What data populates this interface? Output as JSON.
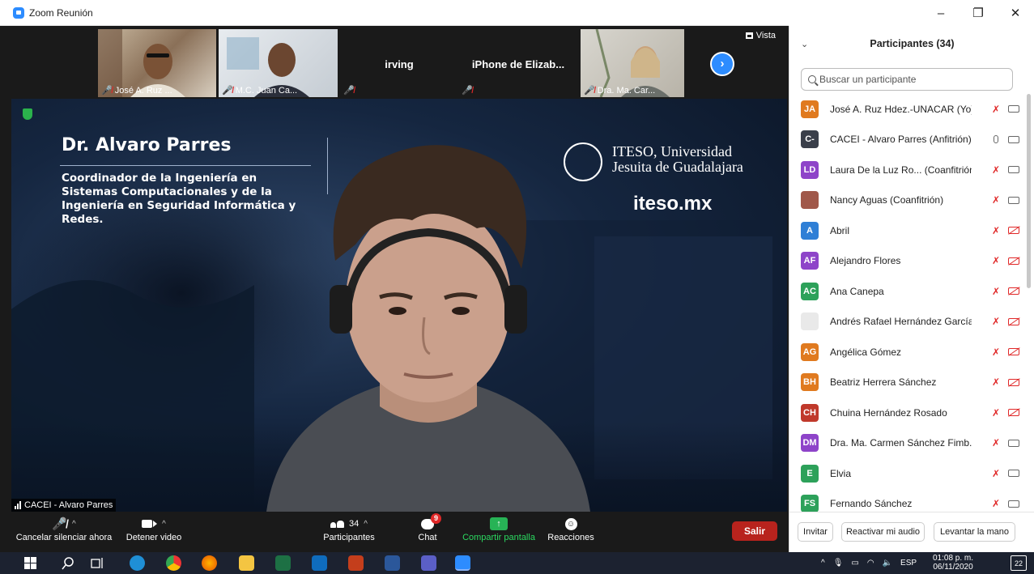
{
  "window": {
    "title": "Zoom Reunión",
    "minimize": "–",
    "maximize": "❐",
    "close": "✕"
  },
  "strip": {
    "thumbnails": [
      {
        "label": "José A. Ruz ...",
        "muted": true
      },
      {
        "label": "M.C. Juan Ca...",
        "muted": true
      },
      {
        "center_name": "irving",
        "muted": true
      },
      {
        "center_name": "iPhone de Elizab...",
        "muted": true
      },
      {
        "label": "Dra. Ma. Car...",
        "muted": true
      }
    ],
    "view_label": "Vista",
    "next_icon": "chevron-right-icon"
  },
  "main_video": {
    "slide_name": "Dr. Alvaro Parres",
    "slide_role": "Coordinador de la Ingeniería en Sistemas Computacionales y de la Ingeniería en Seguridad Informática y Redes.",
    "org_name_line1": "ITESO, Universidad",
    "org_name_line2": "Jesuita de Guadalajara",
    "org_url": "iteso.mx",
    "participant_label": "CACEI - Alvaro Parres"
  },
  "toolbar": {
    "mute_label": "Cancelar silenciar ahora",
    "video_label": "Detener video",
    "participants_label": "Participantes",
    "participants_count": "34",
    "chat_label": "Chat",
    "chat_badge": "9",
    "share_label": "Compartir pantalla",
    "reactions_label": "Reacciones",
    "leave_label": "Salir"
  },
  "panel": {
    "title": "Participantes (34)",
    "search_placeholder": "Buscar un participante",
    "participants": [
      {
        "initials": "JA",
        "color": "#e07a1f",
        "name": "José A. Ruz Hdez.-UNACAR (Yo)",
        "mic": "off",
        "video": "on"
      },
      {
        "initials": "C-",
        "color": "#3a3f4a",
        "name": "CACEI - Alvaro Parres (Anfitrión)",
        "mic": "on",
        "video": "on"
      },
      {
        "initials": "LD",
        "color": "#8e44c9",
        "name": "Laura De la Luz Ro... (Coanfitrión)",
        "mic": "off",
        "video": "on"
      },
      {
        "initials": "",
        "color": "#a0584a",
        "name": "Nancy Aguas (Coanfitrión)",
        "mic": "off",
        "video": "on"
      },
      {
        "initials": "A",
        "color": "#2f7fd6",
        "name": "Abril",
        "mic": "off",
        "video": "off"
      },
      {
        "initials": "AF",
        "color": "#8e44c9",
        "name": "Alejandro Flores",
        "mic": "off",
        "video": "off"
      },
      {
        "initials": "AC",
        "color": "#2da15a",
        "name": "Ana Canepa",
        "mic": "off",
        "video": "off"
      },
      {
        "initials": "",
        "color": "#e9e9e9",
        "name": "Andrés Rafael Hernández García",
        "mic": "off",
        "video": "off"
      },
      {
        "initials": "AG",
        "color": "#e07a1f",
        "name": "Angélica Gómez",
        "mic": "off",
        "video": "off"
      },
      {
        "initials": "BH",
        "color": "#e07a1f",
        "name": "Beatriz Herrera Sánchez",
        "mic": "off",
        "video": "off"
      },
      {
        "initials": "CH",
        "color": "#c0392b",
        "name": "Chuina Hernández Rosado",
        "mic": "off",
        "video": "off"
      },
      {
        "initials": "DM",
        "color": "#8e44c9",
        "name": "Dra. Ma. Carmen Sánchez Fimb...",
        "mic": "off",
        "video": "on"
      },
      {
        "initials": "E",
        "color": "#2da15a",
        "name": "Elvia",
        "mic": "off",
        "video": "on"
      },
      {
        "initials": "FS",
        "color": "#2da15a",
        "name": "Fernando Sánchez",
        "mic": "off",
        "video": "on"
      }
    ],
    "invite_label": "Invitar",
    "unmute_all_label": "Reactivar mi audio",
    "raise_hand_label": "Levantar la mano"
  },
  "taskbar": {
    "lang": "ESP",
    "time": "01:08 p. m.",
    "date": "06/11/2020",
    "notifications": "22"
  }
}
